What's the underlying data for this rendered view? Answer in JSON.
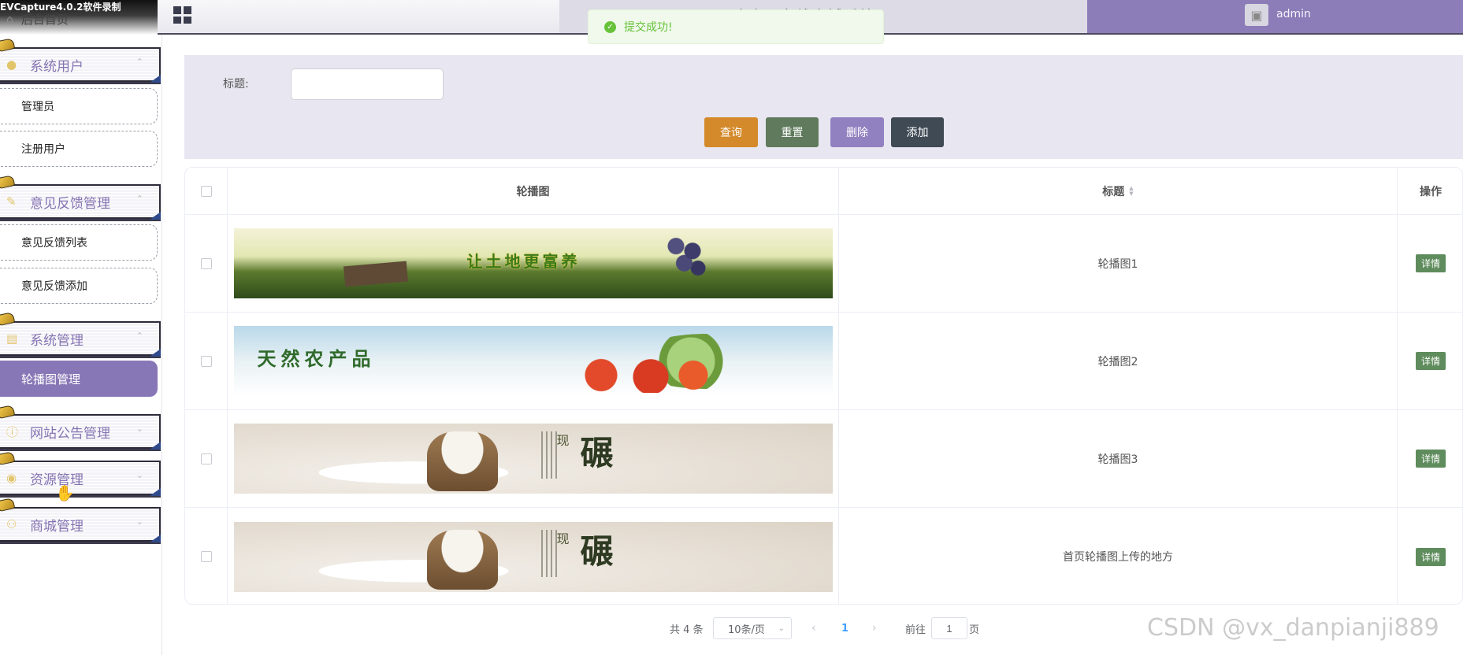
{
  "recorder": "EVCapture4.0.2软件录制",
  "header": {
    "home_label": "后台首页",
    "system_title": "农产品在线商城系统",
    "user_name": "admin"
  },
  "toast": {
    "message": "提交成功!"
  },
  "sidebar": {
    "groups": [
      {
        "label": "系统用户",
        "icon": "user-icon"
      },
      {
        "label": "意见反馈管理",
        "icon": "feedback-icon"
      },
      {
        "label": "系统管理",
        "icon": "image-icon"
      },
      {
        "label": "网站公告管理",
        "icon": "info-icon"
      },
      {
        "label": "资源管理",
        "icon": "location-icon"
      },
      {
        "label": "商城管理",
        "icon": "cart-icon"
      }
    ],
    "items": [
      {
        "label": "管理员"
      },
      {
        "label": "注册用户"
      },
      {
        "label": "意见反馈列表"
      },
      {
        "label": "意见反馈添加"
      },
      {
        "label": "轮播图管理",
        "active": true
      }
    ]
  },
  "search": {
    "title_label": "标题:",
    "title_value": "",
    "buttons": {
      "query": "查询",
      "reset": "重置",
      "delete": "删除",
      "add": "添加"
    }
  },
  "table": {
    "headers": {
      "image": "轮播图",
      "title": "标题",
      "actions": "操作"
    },
    "rows": [
      {
        "title": "轮播图1",
        "banner_text": "让土地更富养",
        "action": "详情"
      },
      {
        "title": "轮播图2",
        "banner_text": "天然农产品",
        "action": "详情"
      },
      {
        "title": "轮播图3",
        "banner_text": "碾",
        "banner_small": "现",
        "action": "详情"
      },
      {
        "title": "首页轮播图上传的地方",
        "banner_text": "碾",
        "banner_small": "现",
        "action": "详情"
      }
    ]
  },
  "pagination": {
    "total": "共 4 条",
    "page_size": "10条/页",
    "current_page": "1",
    "goto_prefix": "前往",
    "goto_value": "1",
    "goto_suffix": "页"
  },
  "watermark": "CSDN @vx_danpianji889"
}
